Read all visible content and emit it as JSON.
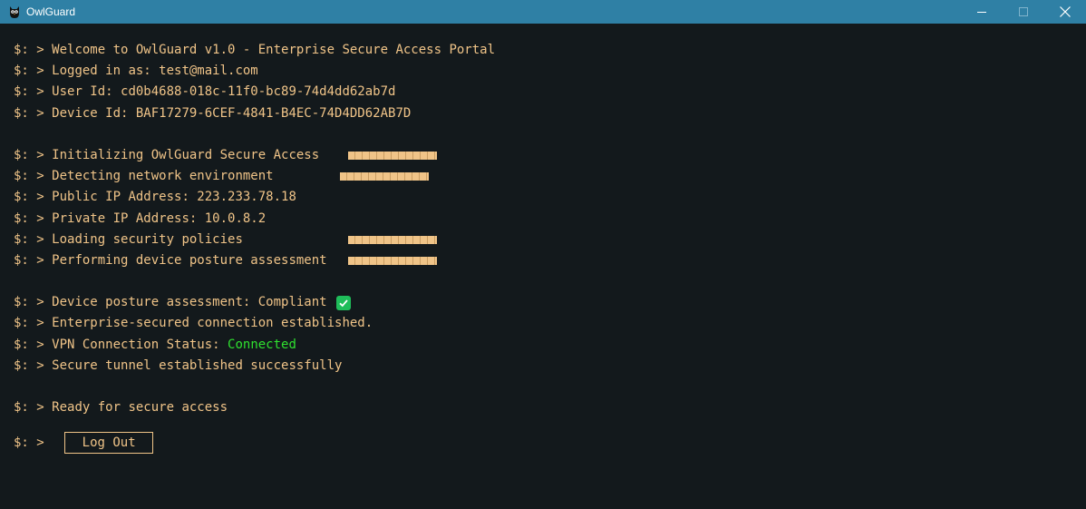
{
  "window": {
    "title": "OwlGuard",
    "icon": "owl-icon",
    "titlebar_color": "#2f80a5"
  },
  "terminal": {
    "prompt": "$: > ",
    "lines": {
      "welcome": "Welcome to OwlGuard v1.0 - Enterprise Secure Access Portal",
      "logged_in": "Logged in as: test@mail.com",
      "user_id": "User Id: cd0b4688-018c-11f0-bc89-74d4dd62ab7d",
      "device_id": "Device Id: BAF17279-6CEF-4841-B4EC-74D4DD62AB7D",
      "initializing": "Initializing OwlGuard Secure Access",
      "detecting": "Detecting network environment",
      "public_ip": "Public IP Address: 223.233.78.18",
      "private_ip": "Private IP Address: 10.0.8.2",
      "loading_policies": "Loading security policies",
      "posture": "Performing device posture assessment",
      "posture_result": "Device posture assessment: Compliant",
      "connection": "Enterprise-secured connection established.",
      "vpn_label": "VPN Connection Status: ",
      "vpn_status": "Connected",
      "tunnel": "Secure tunnel established successfully",
      "ready": "Ready for secure access"
    },
    "progress": {
      "initializing": 1.0,
      "detecting": 1.0,
      "loading_policies": 1.0,
      "posture": 1.0
    },
    "colors": {
      "text": "#f0c488",
      "background": "#13191c",
      "connected": "#2fe02f",
      "check": "#1fbd5a"
    }
  },
  "actions": {
    "logout_label": "Log Out"
  }
}
